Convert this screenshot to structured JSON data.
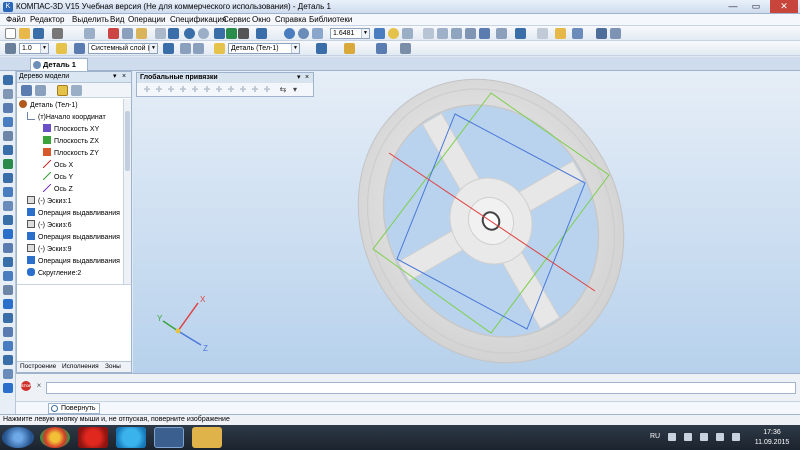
{
  "window": {
    "title": "КОМПАС-3D V15 Учебная версия (Не для коммерческого использования) - Деталь 1",
    "min": "—",
    "max": "▭",
    "close": "✕"
  },
  "menu": [
    "Файл",
    "Редактор",
    "Выделить",
    "Вид",
    "Операции",
    "Спецификация",
    "Сервис",
    "Окно",
    "Справка",
    "Библиотеки"
  ],
  "toolbar1": {
    "scale_value": "1.6481"
  },
  "toolbar2": {
    "step_value": "1.0",
    "layer_value": "Системный слой (0)",
    "part_value": "Деталь (Тел-1)"
  },
  "document_tab": "Деталь 1",
  "tree": {
    "header": "Дерево модели",
    "header_pin": "▾",
    "header_close": "×",
    "items": [
      {
        "label": "Деталь (Тел-1)",
        "icon": "part-icon",
        "color": "#b05a1e"
      },
      {
        "label": "(т)Начало координат",
        "icon": "origin-icon",
        "color": "#6d86a8"
      },
      {
        "label": "Плоскость XY",
        "icon": "plane-xy-icon",
        "color": "#6b4fc7"
      },
      {
        "label": "Плоскость ZX",
        "icon": "plane-zx-icon",
        "color": "#3aa33a"
      },
      {
        "label": "Плоскость ZY",
        "icon": "plane-zy-icon",
        "color": "#d9582b"
      },
      {
        "label": "Ось X",
        "icon": "axis-x-icon",
        "color": "#d12f2f"
      },
      {
        "label": "Ось Y",
        "icon": "axis-y-icon",
        "color": "#3aa33a"
      },
      {
        "label": "Ось Z",
        "icon": "axis-z-icon",
        "color": "#7a3cc0"
      },
      {
        "label": "(-) Эскиз:1",
        "icon": "sketch-icon",
        "color": "#555555"
      },
      {
        "label": "Операция выдавливания",
        "icon": "extrude-icon",
        "color": "#2a6fc9"
      },
      {
        "label": "(-) Эскиз:6",
        "icon": "sketch-icon",
        "color": "#555555"
      },
      {
        "label": "Операция выдавливания",
        "icon": "extrude-icon",
        "color": "#2a6fc9"
      },
      {
        "label": "(-) Эскиз:9",
        "icon": "sketch-icon",
        "color": "#555555"
      },
      {
        "label": "Операция выдавливания",
        "icon": "extrude-icon",
        "color": "#2a6fc9"
      },
      {
        "label": "Скругление:2",
        "icon": "fillet-icon",
        "color": "#2a6fc9"
      }
    ],
    "tabs": [
      "Построение",
      "Исполнения",
      "Зоны"
    ]
  },
  "snap_panel": {
    "title": "Глобальные привязки",
    "pin": "▾",
    "close": "×"
  },
  "axis_labels": {
    "x": "X",
    "y": "Y",
    "z": "Z"
  },
  "command": {
    "stop_label": "STOP",
    "close": "×",
    "rotate_button": "Повернуть"
  },
  "status_text": "Нажмите левую кнопку мыши и, не отпуская, поверните изображение",
  "taskbar": {
    "lang": "RU",
    "time": "17:36",
    "date": "11.09.2015"
  },
  "colors": {
    "accent": "#2a66b8",
    "viewport_top": "#e6eef7",
    "viewport_bottom": "#b7d1ec",
    "part_fill": "#e9e9e9",
    "plane_blue": "#4a78d8",
    "plane_green": "#7ccf4a",
    "axis_red": "#e04040"
  }
}
